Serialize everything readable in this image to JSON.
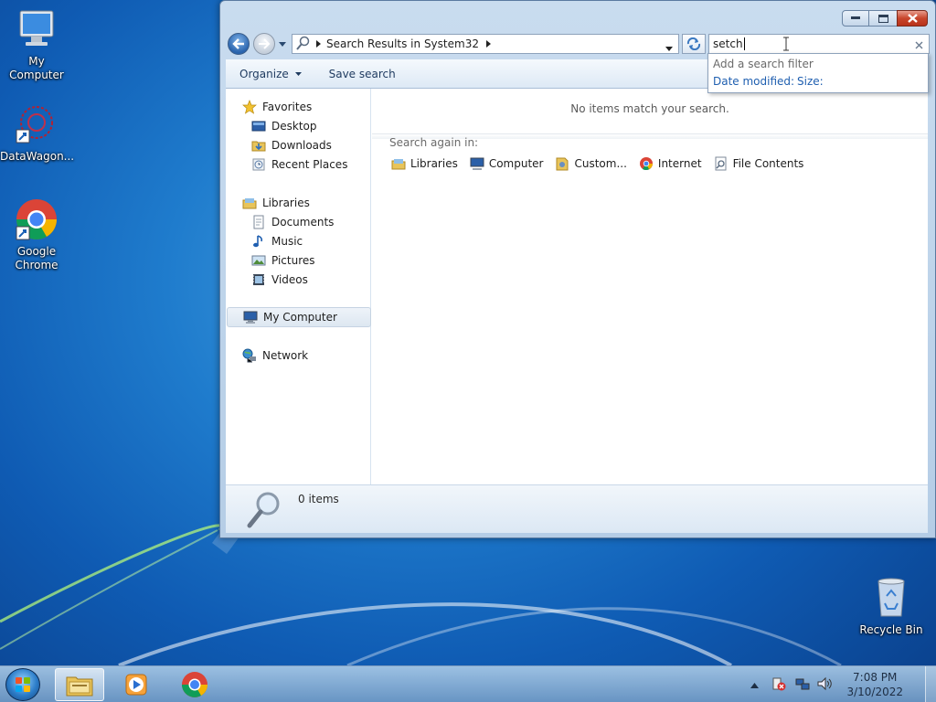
{
  "desktop": {
    "icons": [
      {
        "label": "My Computer"
      },
      {
        "label": "DataWagon..."
      },
      {
        "label": "Google Chrome"
      },
      {
        "label": "Recycle Bin"
      }
    ]
  },
  "window": {
    "address": {
      "crumb": "Search Results in System32"
    },
    "search": {
      "value": "setch",
      "dropdown_hint": "Add a search filter",
      "filters": [
        "Date modified:",
        "Size:"
      ]
    },
    "toolbar": {
      "organize": "Organize",
      "save_search": "Save search"
    },
    "nav": {
      "favorites": "Favorites",
      "desktop": "Desktop",
      "downloads": "Downloads",
      "recent": "Recent Places",
      "libraries": "Libraries",
      "documents": "Documents",
      "music": "Music",
      "pictures": "Pictures",
      "videos": "Videos",
      "my_computer": "My Computer",
      "network": "Network"
    },
    "main": {
      "empty_message": "No items match your search.",
      "search_again": "Search again in:",
      "locations": [
        "Libraries",
        "Computer",
        "Custom...",
        "Internet",
        "File Contents"
      ]
    },
    "status": {
      "count": "0 items"
    }
  },
  "taskbar": {
    "time": "7:08 PM",
    "date": "3/10/2022"
  }
}
